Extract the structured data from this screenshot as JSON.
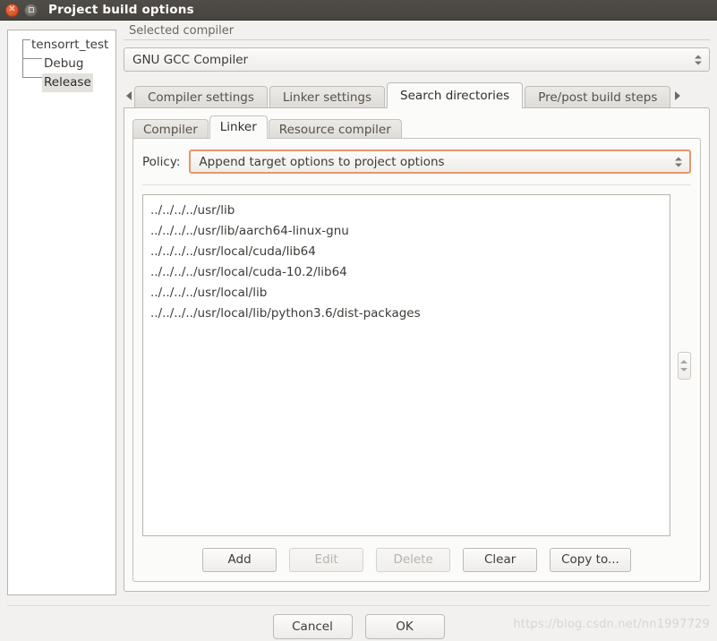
{
  "window": {
    "title": "Project build options",
    "close_icon": "close-icon",
    "maximize_icon": "maximize-icon",
    "titlebar_color": "#47443f"
  },
  "tree": {
    "nodes": [
      {
        "label": "tensorrt_test",
        "level": 0,
        "selected": false
      },
      {
        "label": "Debug",
        "level": 1,
        "selected": false
      },
      {
        "label": "Release",
        "level": 1,
        "selected": true
      }
    ]
  },
  "compiler_group": {
    "legend": "Selected compiler",
    "selected": "GNU GCC Compiler",
    "spinner_up_icon": "triangle-up-icon",
    "spinner_down_icon": "triangle-down-icon"
  },
  "outer_tabs": {
    "scroll_left_icon": "arrow-left-icon",
    "scroll_right_icon": "arrow-right-icon",
    "items": [
      {
        "label": "Compiler settings",
        "active": false
      },
      {
        "label": "Linker settings",
        "active": false
      },
      {
        "label": "Search directories",
        "active": true
      },
      {
        "label": "Pre/post build steps",
        "active": false
      }
    ]
  },
  "inner_tabs": {
    "items": [
      {
        "label": "Compiler",
        "active": false
      },
      {
        "label": "Linker",
        "active": true
      },
      {
        "label": "Resource compiler",
        "active": false
      }
    ]
  },
  "policy": {
    "label": "Policy:",
    "value": "Append target options to project options",
    "focus_border_color": "#e8956b",
    "spinner_up_icon": "triangle-up-icon",
    "spinner_down_icon": "triangle-down-icon"
  },
  "directory_list": {
    "items": [
      "../../../../usr/lib",
      "../../../../usr/lib/aarch64-linux-gnu",
      "../../../../usr/local/cuda/lib64",
      "../../../../usr/local/cuda-10.2/lib64",
      "../../../../usr/local/lib",
      "../../../../usr/local/lib/python3.6/dist-packages"
    ]
  },
  "reorder_spinner": {
    "up_icon": "triangle-up-icon",
    "down_icon": "triangle-down-icon"
  },
  "action_buttons": [
    {
      "label": "Add",
      "enabled": true
    },
    {
      "label": "Edit",
      "enabled": false
    },
    {
      "label": "Delete",
      "enabled": false
    },
    {
      "label": "Clear",
      "enabled": true
    },
    {
      "label": "Copy to...",
      "enabled": true
    }
  ],
  "dialog_buttons": [
    {
      "label": "Cancel"
    },
    {
      "label": "OK"
    }
  ],
  "watermark": {
    "text": "https://blog.csdn.net/nn1997729"
  }
}
